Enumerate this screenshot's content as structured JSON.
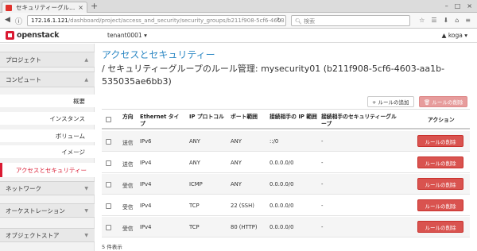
{
  "browser": {
    "tab_title": "セキュリティーグル...",
    "tab_close": "×",
    "new_tab": "+",
    "url_host": "172.16.1.121",
    "url_path": "/dashboard/project/access_and_security/security_groups/b211f908-5cf6-4603",
    "search_placeholder": "検索",
    "min_icon": "–",
    "max_icon": "□",
    "close_icon": "×"
  },
  "header": {
    "logo_text": "openstack",
    "tenant": "tenant0001 ▾",
    "user": "▲ koga ▾"
  },
  "sidebar": {
    "project": "プロジェクト",
    "compute": "コンピュート",
    "items": [
      "概要",
      "インスタンス",
      "ボリューム",
      "イメージ"
    ],
    "active": "アクセスとセキュリティー",
    "network": "ネットワーク",
    "orchestration": "オーケストレーション",
    "object_store": "オブジェクトストア"
  },
  "main": {
    "title": "アクセスとセキュリティー",
    "subheading": "/ セキュリティーグループのルール管理: mysecurity01 (b211f908-5cf6-4603-aa1b-535035ae6bb3)",
    "add_rule": "+ ルールの追加",
    "delete_rules": "🗑 ルールの削除",
    "columns": {
      "direction": "方向",
      "ethertype": "Ethernet タイプ",
      "protocol": "IP プロトコル",
      "port_range": "ポート範囲",
      "remote_ip": "接続相手の IP 範囲",
      "remote_sg": "接続相手のセキュリティーグループ",
      "actions": "アクション"
    },
    "rows": [
      {
        "direction": "送信",
        "ethertype": "IPv6",
        "protocol": "ANY",
        "port_range": "ANY",
        "remote_ip": "::/0",
        "remote_sg": "-",
        "action": "ルールの削除"
      },
      {
        "direction": "送信",
        "ethertype": "IPv4",
        "protocol": "ANY",
        "port_range": "ANY",
        "remote_ip": "0.0.0.0/0",
        "remote_sg": "-",
        "action": "ルールの削除"
      },
      {
        "direction": "受信",
        "ethertype": "IPv4",
        "protocol": "ICMP",
        "port_range": "ANY",
        "remote_ip": "0.0.0.0/0",
        "remote_sg": "-",
        "action": "ルールの削除"
      },
      {
        "direction": "受信",
        "ethertype": "IPv4",
        "protocol": "TCP",
        "port_range": "22 (SSH)",
        "remote_ip": "0.0.0.0/0",
        "remote_sg": "-",
        "action": "ルールの削除"
      },
      {
        "direction": "受信",
        "ethertype": "IPv4",
        "protocol": "TCP",
        "port_range": "80 (HTTP)",
        "remote_ip": "0.0.0.0/0",
        "remote_sg": "-",
        "action": "ルールの削除"
      }
    ],
    "footer": "5 件表示"
  },
  "colors": {
    "brand": "#da1a32",
    "link": "#2d88c4",
    "danger": "#d9534f"
  }
}
